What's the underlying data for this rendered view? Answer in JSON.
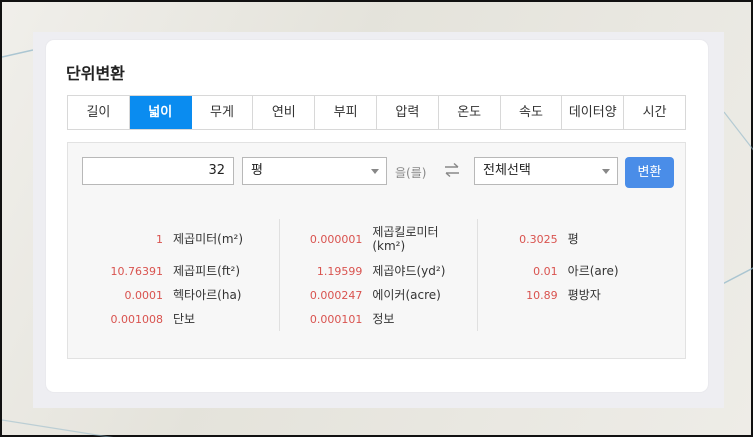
{
  "title": "단위변환",
  "tabs": [
    {
      "label": "길이",
      "active": false
    },
    {
      "label": "넓이",
      "active": true
    },
    {
      "label": "무게",
      "active": false
    },
    {
      "label": "연비",
      "active": false
    },
    {
      "label": "부피",
      "active": false
    },
    {
      "label": "압력",
      "active": false
    },
    {
      "label": "온도",
      "active": false
    },
    {
      "label": "속도",
      "active": false
    },
    {
      "label": "데이터양",
      "active": false
    },
    {
      "label": "시간",
      "active": false
    }
  ],
  "converter": {
    "input_value": "32",
    "from_unit": "평",
    "connector": "을(를)",
    "to_unit": "전체선택",
    "convert_label": "변환"
  },
  "results": {
    "col1": [
      {
        "value": "1",
        "unit": "제곱미터(m²)"
      },
      {
        "value": "10.76391",
        "unit": "제곱피트(ft²)"
      },
      {
        "value": "0.0001",
        "unit": "헥타아르(ha)"
      },
      {
        "value": "0.001008",
        "unit": "단보"
      }
    ],
    "col2": [
      {
        "value": "0.000001",
        "unit": "제곱킬로미터(km²)"
      },
      {
        "value": "1.19599",
        "unit": "제곱야드(yd²)"
      },
      {
        "value": "0.000247",
        "unit": "에이커(acre)"
      },
      {
        "value": "0.000101",
        "unit": "정보"
      }
    ],
    "col3": [
      {
        "value": "0.3025",
        "unit": "평"
      },
      {
        "value": "0.01",
        "unit": "아르(are)"
      },
      {
        "value": "10.89",
        "unit": "평방자"
      }
    ]
  },
  "colors": {
    "active_tab": "#0a8cf0",
    "convert_button": "#4a8de8",
    "result_value": "#d9534f"
  }
}
